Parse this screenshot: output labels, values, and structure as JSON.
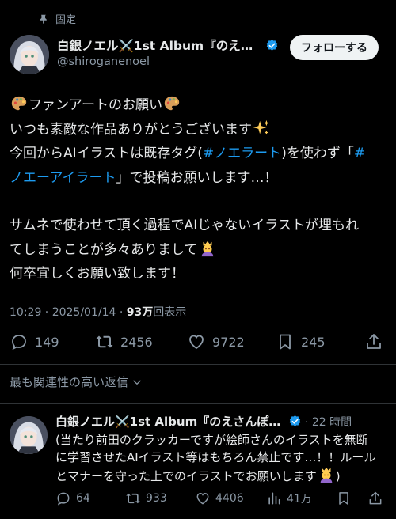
{
  "pinned": {
    "label": "固定",
    "icon": "pin-icon"
  },
  "tweet": {
    "author": {
      "name": "白銀ノエル⚔️1st Album『のえさ…",
      "handle": "@shiroganenoel",
      "verified": true
    },
    "follow_label": "フォローする",
    "text": {
      "l1": "ファンアートのお願い",
      "l2": "いつも素敵な作品ありがとうございます",
      "l3a": "今回からAIイラストは既存タグ(",
      "l3tag": "#ノエラート",
      "l3b": ")を使わず「",
      "l3tag2": "#",
      "l4tag": "ノエーアイラート",
      "l4b": "」で投稿お願いします…！",
      "l5": "サムネで使わせて頂く過程でAIじゃないイラストが埋もれ",
      "l6": "てしまうことが多々ありまして",
      "l7": "何卒宜しくお願い致します！"
    },
    "time": "10:29 · 2025/01/14 · ",
    "views_count": "93万",
    "views_label": "回表示",
    "stats": {
      "replies": "149",
      "retweets": "2456",
      "likes": "9722",
      "bookmarks": "245"
    }
  },
  "relevant_label": "最も関連性の高い返信",
  "reply": {
    "author": {
      "name": "白銀ノエル⚔️1st Album『のえさんぽ』…",
      "verified": true
    },
    "time": "· 22 時間",
    "text": {
      "l1": "(当たり前田のクラッカーですが絵師さんのイラストを無断",
      "l2": "に学習させたAIイラスト等はもちろん禁止です…！！ルール",
      "l3": "とマナーを守った上でのイラストでお願いします"
    },
    "text_end": ")",
    "stats": {
      "replies": "64",
      "retweets": "933",
      "likes": "4406",
      "views": "41万"
    }
  },
  "colors": {
    "background": "#000000",
    "accent": "#1d9bf0",
    "secondary_text": "#8b98a5",
    "divider": "#2f3336"
  }
}
